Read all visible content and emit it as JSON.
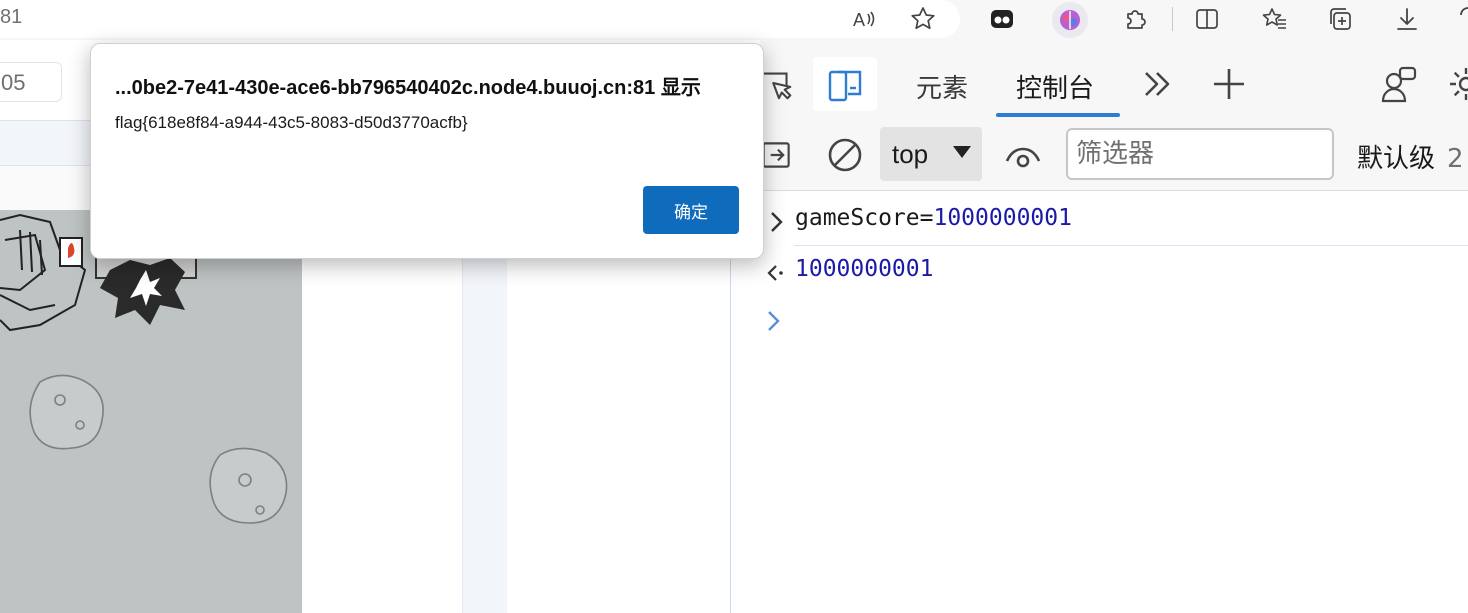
{
  "browser": {
    "address_fragment": "81",
    "toolbar_icons": [
      "read-aloud-icon",
      "favorite-star-icon",
      "extension-app-icon",
      "copilot-icon",
      "extensions-puzzle-icon",
      "split-screen-icon",
      "favorites-icon",
      "collections-icon",
      "downloads-icon",
      "help-icon"
    ]
  },
  "page": {
    "partial_input_value": "05"
  },
  "devtools": {
    "tabs": [
      {
        "label": "元素"
      },
      {
        "label": "控制台",
        "active": true
      }
    ],
    "context": "top",
    "filter_placeholder": "筛选器",
    "levels_label": "默认级",
    "issues_count": "2",
    "accent_color": "#2d7dd2"
  },
  "console": {
    "input_expr_prefix": "gameScore=",
    "input_expr_value": "1000000001",
    "result_value": "1000000001",
    "number_color": "#1a1aa6"
  },
  "dialog": {
    "title": "...0be2-7e41-430e-ace6-bb796540402c.node4.buuoj.cn:81 显示",
    "message": "flag{618e8f84-a944-43c5-8083-d50d3770acfb}",
    "ok_label": "确定",
    "button_color": "#0f6cbd"
  }
}
